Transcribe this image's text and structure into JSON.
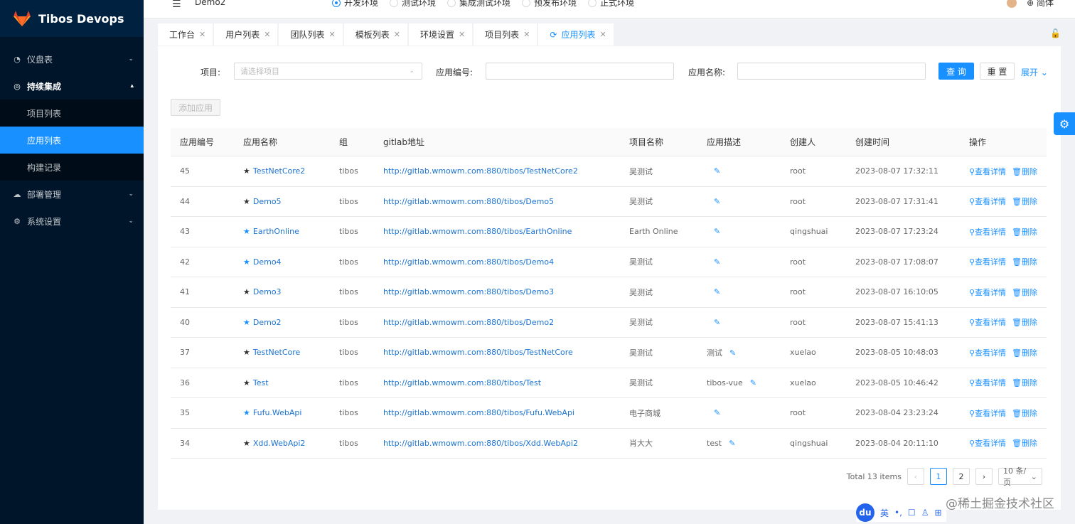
{
  "app": {
    "title": "Tibos Devops"
  },
  "sidebar": {
    "items": [
      {
        "label": "仪盘表",
        "icon": "dashboard-icon"
      },
      {
        "label": "持续集成",
        "icon": "ci-icon"
      },
      {
        "label": "部署管理",
        "icon": "cloud-icon"
      },
      {
        "label": "系统设置",
        "icon": "gear-icon"
      }
    ],
    "submenu": [
      {
        "label": "项目列表"
      },
      {
        "label": "应用列表"
      },
      {
        "label": "构建记录"
      }
    ]
  },
  "header": {
    "project": "Demo2",
    "envs": [
      "开发环境",
      "测试环境",
      "集成测试环境",
      "预发布环境",
      "正式环境"
    ],
    "user": "简体"
  },
  "tabs": [
    {
      "label": "工作台"
    },
    {
      "label": "用户列表"
    },
    {
      "label": "团队列表"
    },
    {
      "label": "模板列表"
    },
    {
      "label": "环境设置"
    },
    {
      "label": "项目列表"
    },
    {
      "label": "应用列表"
    }
  ],
  "filters": {
    "project_label": "项目:",
    "project_placeholder": "请选择项目",
    "code_label": "应用编号:",
    "name_label": "应用名称:",
    "query": "查 询",
    "reset": "重 置",
    "expand": "展开"
  },
  "add_button": "添加应用",
  "table": {
    "headers": [
      "应用编号",
      "应用名称",
      "组",
      "gitlab地址",
      "项目名称",
      "应用描述",
      "创建人",
      "创建时间",
      "操作"
    ],
    "op_view": "查看详情",
    "op_delete": "删除",
    "rows": [
      {
        "id": "45",
        "name": "TestNetCore2",
        "starred": false,
        "group": "tibos",
        "url": "http://gitlab.wmowm.com:880/tibos/TestNetCore2",
        "project": "吴测试",
        "desc": "",
        "creator": "root",
        "time": "2023-08-07 17:32:11"
      },
      {
        "id": "44",
        "name": "Demo5",
        "starred": false,
        "group": "tibos",
        "url": "http://gitlab.wmowm.com:880/tibos/Demo5",
        "project": "吴测试",
        "desc": "",
        "creator": "root",
        "time": "2023-08-07 17:31:41"
      },
      {
        "id": "43",
        "name": "EarthOnline",
        "starred": true,
        "group": "tibos",
        "url": "http://gitlab.wmowm.com:880/tibos/EarthOnline",
        "project": "Earth Online",
        "desc": "",
        "creator": "qingshuai",
        "time": "2023-08-07 17:23:24"
      },
      {
        "id": "42",
        "name": "Demo4",
        "starred": true,
        "group": "tibos",
        "url": "http://gitlab.wmowm.com:880/tibos/Demo4",
        "project": "吴测试",
        "desc": "",
        "creator": "root",
        "time": "2023-08-07 17:08:07"
      },
      {
        "id": "41",
        "name": "Demo3",
        "starred": false,
        "group": "tibos",
        "url": "http://gitlab.wmowm.com:880/tibos/Demo3",
        "project": "吴测试",
        "desc": "",
        "creator": "root",
        "time": "2023-08-07 16:10:05"
      },
      {
        "id": "40",
        "name": "Demo2",
        "starred": true,
        "group": "tibos",
        "url": "http://gitlab.wmowm.com:880/tibos/Demo2",
        "project": "吴测试",
        "desc": "",
        "creator": "root",
        "time": "2023-08-07 15:41:13"
      },
      {
        "id": "37",
        "name": "TestNetCore",
        "starred": false,
        "group": "tibos",
        "url": "http://gitlab.wmowm.com:880/tibos/TestNetCore",
        "project": "吴测试",
        "desc": "测试",
        "creator": "xuelao",
        "time": "2023-08-05 10:48:03"
      },
      {
        "id": "36",
        "name": "Test",
        "starred": false,
        "group": "tibos",
        "url": "http://gitlab.wmowm.com:880/tibos/Test",
        "project": "吴测试",
        "desc": "tibos-vue",
        "creator": "xuelao",
        "time": "2023-08-05 10:46:42"
      },
      {
        "id": "35",
        "name": "Fufu.WebApi",
        "starred": true,
        "group": "tibos",
        "url": "http://gitlab.wmowm.com:880/tibos/Fufu.WebApi",
        "project": "电子商城",
        "desc": "",
        "creator": "root",
        "time": "2023-08-04 23:23:24"
      },
      {
        "id": "34",
        "name": "Xdd.WebApi2",
        "starred": false,
        "group": "tibos",
        "url": "http://gitlab.wmowm.com:880/tibos/Xdd.WebApi2",
        "project": "肖大大",
        "desc": "test",
        "creator": "qingshuai",
        "time": "2023-08-04 20:11:10"
      }
    ]
  },
  "pagination": {
    "total": "Total 13 items",
    "pages": [
      "1",
      "2"
    ],
    "page_size": "10 条/页"
  },
  "ime": {
    "logo": "du",
    "lang": "英"
  },
  "watermark": "@稀土掘金技术社区"
}
